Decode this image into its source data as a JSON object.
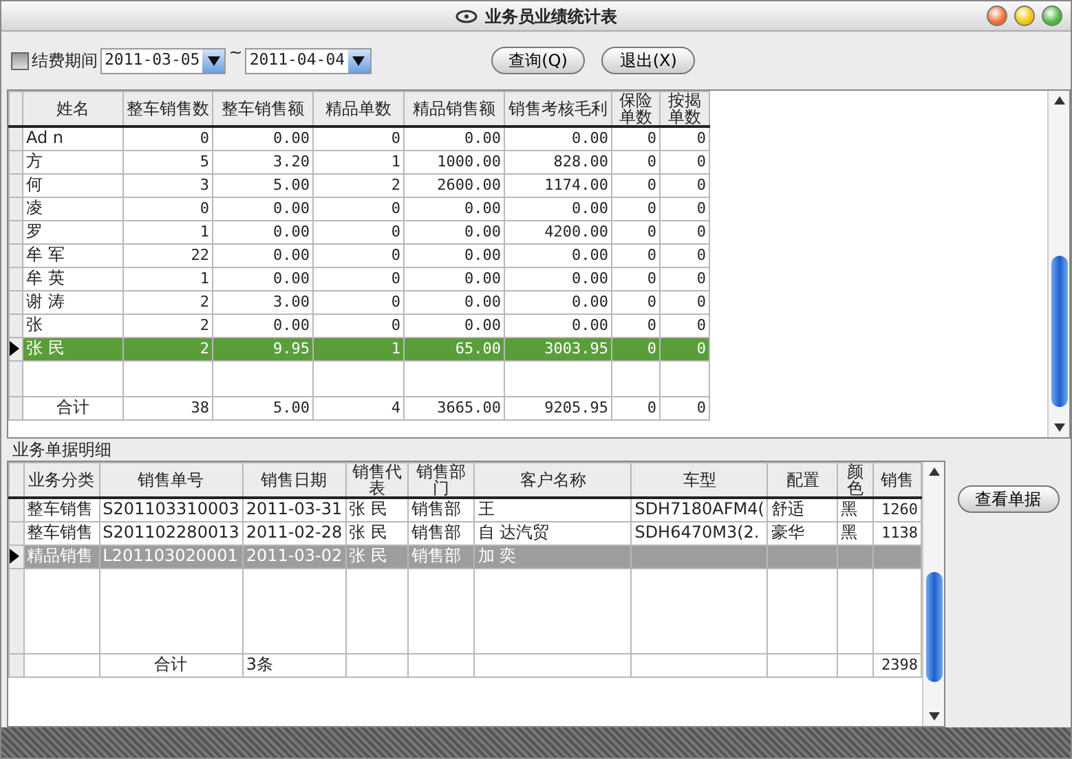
{
  "window": {
    "title": "业务员业绩统计表"
  },
  "filter": {
    "label": "结费期间",
    "checked": false,
    "date_from": "2011-03-05",
    "separator": "~",
    "date_to": "2011-04-04"
  },
  "buttons": [
    {
      "label": "查询(Q)"
    },
    {
      "label": "退出(X)"
    }
  ],
  "summary_table": {
    "columns": [
      "姓名",
      "整车销售数",
      "整车销售额",
      "精品单数",
      "精品销售额",
      "销售考核毛利",
      "保险单数",
      "按揭单数"
    ],
    "rows": [
      {
        "cells": [
          "Ad n",
          "0",
          "0.00",
          "0",
          "0.00",
          "0.00",
          "0",
          "0"
        ],
        "selected": false
      },
      {
        "cells": [
          "方",
          "5",
          "3.20",
          "1",
          "1000.00",
          "828.00",
          "0",
          "0"
        ],
        "selected": false
      },
      {
        "cells": [
          "何",
          "3",
          "5.00",
          "2",
          "2600.00",
          "1174.00",
          "0",
          "0"
        ],
        "selected": false
      },
      {
        "cells": [
          "凌",
          "0",
          "0.00",
          "0",
          "0.00",
          "0.00",
          "0",
          "0"
        ],
        "selected": false
      },
      {
        "cells": [
          "罗",
          "1",
          "0.00",
          "0",
          "0.00",
          "4200.00",
          "0",
          "0"
        ],
        "selected": false
      },
      {
        "cells": [
          "牟 军",
          "22",
          "0.00",
          "0",
          "0.00",
          "0.00",
          "0",
          "0"
        ],
        "selected": false
      },
      {
        "cells": [
          "牟 英",
          "1",
          "0.00",
          "0",
          "0.00",
          "0.00",
          "0",
          "0"
        ],
        "selected": false
      },
      {
        "cells": [
          "谢 涛",
          "2",
          "3.00",
          "0",
          "0.00",
          "0.00",
          "0",
          "0"
        ],
        "selected": false
      },
      {
        "cells": [
          "张",
          "2",
          "0.00",
          "0",
          "0.00",
          "0.00",
          "0",
          "0"
        ],
        "selected": false
      },
      {
        "cells": [
          "张 民",
          "2",
          "9.95",
          "1",
          "65.00",
          "3003.95",
          "0",
          "0"
        ],
        "selected": true
      }
    ],
    "total": [
      "合计",
      "38",
      "5.00",
      "4",
      "3665.00",
      "9205.95",
      "0",
      "0"
    ]
  },
  "detail_section": {
    "title": "业务单据明细",
    "columns": [
      "业务分类",
      "销售单号",
      "销售日期",
      "销售代表",
      "销售部门",
      "客户名称",
      "车型",
      "配置",
      "颜色",
      "销售"
    ],
    "rows": [
      {
        "cells": [
          "整车销售",
          "S201103310003",
          "2011-03-31",
          "张 民",
          "销售部",
          "王",
          "SDH7180AFM4(",
          "舒适",
          "黑",
          "1260"
        ],
        "selected": false
      },
      {
        "cells": [
          "整车销售",
          "S201102280013",
          "2011-02-28",
          "张 民",
          "销售部",
          "自 达汽贸",
          "SDH6470M3(2.",
          "豪华",
          "黑",
          "1138"
        ],
        "selected": false
      },
      {
        "cells": [
          "精品销售",
          "L201103020001",
          "2011-03-02",
          "张 民",
          "销售部",
          "加 奕"
        ],
        "selected": true
      }
    ],
    "total": {
      "label": "合计",
      "count": "3条",
      "sales": "2398"
    },
    "view_button": "查看单据"
  }
}
